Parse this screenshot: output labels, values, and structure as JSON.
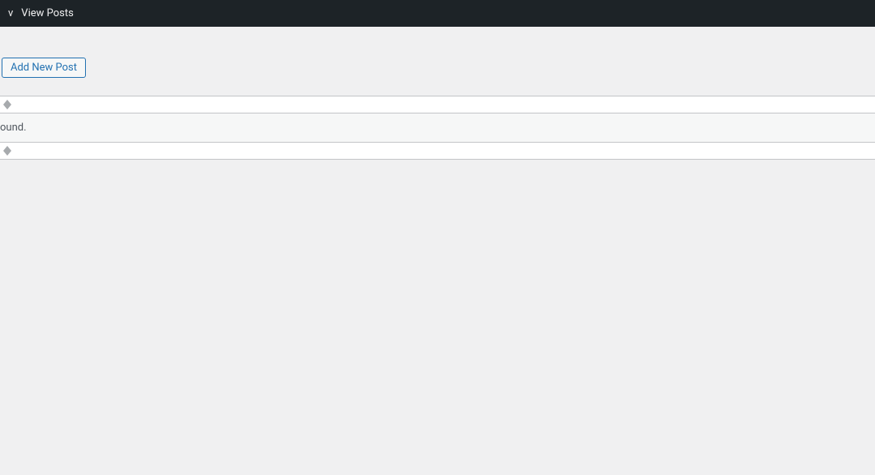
{
  "toolbar": {
    "partial_item": "v",
    "view_posts": "View Posts"
  },
  "header": {
    "add_new_label": "Add New Post"
  },
  "table": {
    "no_results": "ound."
  }
}
